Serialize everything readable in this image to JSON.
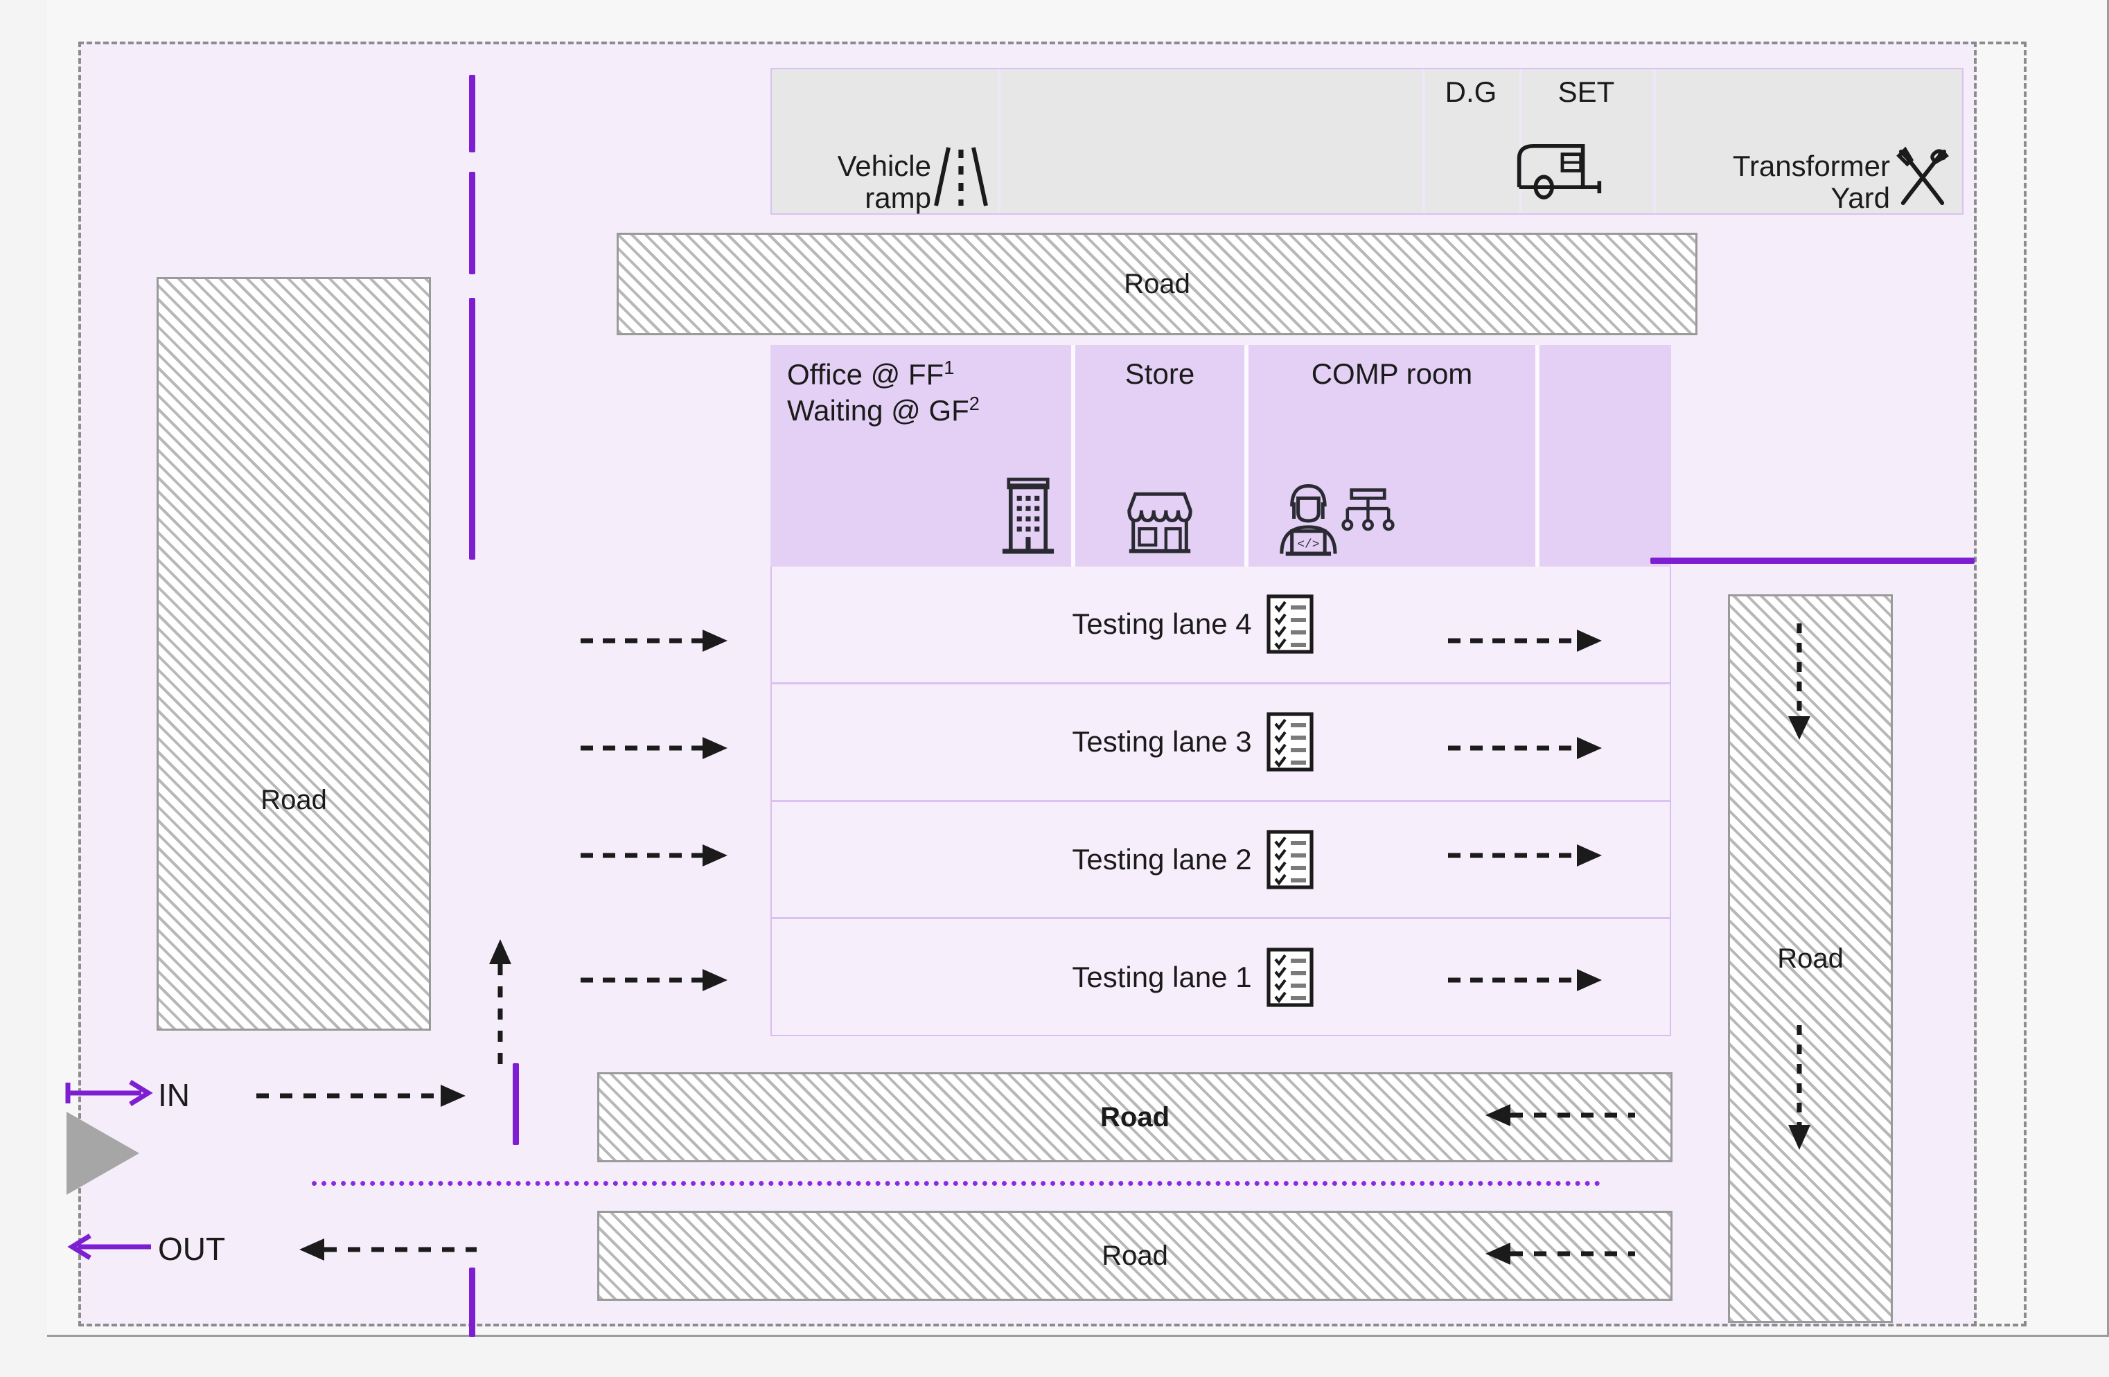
{
  "diagram": {
    "title": "Vehicle testing station facility layout",
    "colors": {
      "accent_purple": "#7d1fd1",
      "plot_background": "#f6edfb",
      "room_fill": "#e4d0f5",
      "utility_fill": "#e7e7e7",
      "hatch_grey": "#b8b8b8",
      "triangle_grey": "#a6a6a6"
    },
    "utility_strip": {
      "cells": [
        {
          "label": "Vehicle\nramp",
          "icon": "road-ramp-icon"
        },
        {
          "label": "",
          "icon": ""
        },
        {
          "label": "D.G",
          "icon": ""
        },
        {
          "label": "SET",
          "icon": "generator-trailer-icon"
        },
        {
          "label": "Transformer\nYard",
          "icon": "tools-crossed-icon"
        }
      ]
    },
    "roads": {
      "top": {
        "label": "Road"
      },
      "left": {
        "label": "Road"
      },
      "right": {
        "label": "Road"
      },
      "bottom_upper": {
        "label": "Road",
        "bold": true
      },
      "bottom_lower": {
        "label": "Road",
        "bold": false
      }
    },
    "rooms": [
      {
        "line1": "Office @ FF",
        "sup1": "1",
        "line2": "Waiting @ GF",
        "sup2": "2",
        "icon": "office-building-icon"
      },
      {
        "label": "Store",
        "icon": "storefront-icon"
      },
      {
        "label": "COMP room",
        "icon": "computer-operator-icon"
      },
      {
        "label": "",
        "icon": ""
      }
    ],
    "testing_lanes": [
      {
        "label": "Testing lane 4",
        "icon": "checklist-icon"
      },
      {
        "label": "Testing lane 3",
        "icon": "checklist-icon"
      },
      {
        "label": "Testing lane 2",
        "icon": "checklist-icon"
      },
      {
        "label": "Testing lane 1",
        "icon": "checklist-icon"
      }
    ],
    "entry_exit": {
      "in_label": "IN",
      "out_label": "OUT"
    }
  }
}
